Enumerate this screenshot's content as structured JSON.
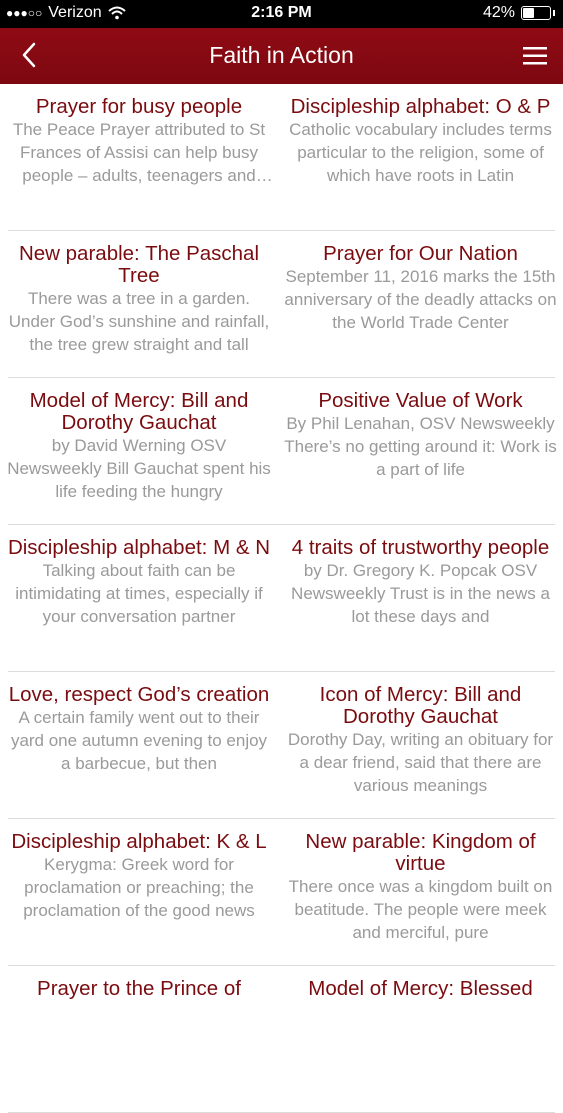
{
  "status": {
    "carrier": "Verizon",
    "time": "2:16 PM",
    "battery": "42%",
    "battery_level": 0.42
  },
  "header": {
    "title": "Faith in Action"
  },
  "articles": [
    {
      "title": "Prayer for busy people",
      "excerpt": "The Peace Prayer attributed to St Frances of Assisi can help busy people – adults, teenagers and children alike"
    },
    {
      "title": "Discipleship alphabet: O & P",
      "excerpt": "Catholic vocabulary includes terms particular to the religion, some of which have roots in Latin"
    },
    {
      "title": "New parable: The Paschal Tree",
      "excerpt": "There was a tree in a garden. Under God’s sunshine and rainfall, the tree grew straight and tall"
    },
    {
      "title": "Prayer for Our Nation",
      "excerpt": "September 11, 2016 marks the 15th anniversary of the deadly attacks on the World Trade Center"
    },
    {
      "title": "Model of Mercy: Bill and Dorothy Gauchat",
      "excerpt": "by David Werning OSV Newsweekly Bill Gauchat spent his life feeding the hungry"
    },
    {
      "title": "Positive Value of Work",
      "excerpt": "By Phil Lenahan, OSV Newsweekly There’s no getting around it: Work is a part of life"
    },
    {
      "title": "Discipleship alphabet: M & N",
      "excerpt": "Talking about faith can be intimidating at times, especially if your conversation partner"
    },
    {
      "title": "4 traits of trustworthy people",
      "excerpt": "by Dr. Gregory K. Popcak OSV Newsweekly Trust is in the news a lot these days and"
    },
    {
      "title": "Love, respect God’s creation",
      "excerpt": "A certain family went out to their yard one autumn evening to enjoy a barbecue, but then"
    },
    {
      "title": "Icon of Mercy: Bill and Dorothy Gauchat",
      "excerpt": "Dorothy Day, writing an obituary for a dear friend, said that there are various meanings"
    },
    {
      "title": "Discipleship alphabet: K & L",
      "excerpt": "Kerygma: Greek word for proclamation or preaching; the proclamation of the good news"
    },
    {
      "title": "New parable: Kingdom of virtue",
      "excerpt": "There once was a kingdom built on beatitude. The people were meek and merciful, pure"
    },
    {
      "title": "Prayer to the Prince of",
      "excerpt": ""
    },
    {
      "title": "Model of Mercy: Blessed",
      "excerpt": ""
    }
  ],
  "colors": {
    "nav_bar": "#8c0a12",
    "title_text": "#7a0c10",
    "excerpt_text": "#9a9a9a"
  },
  "icons": {
    "back": "chevron-left-icon",
    "menu": "hamburger-menu-icon",
    "wifi": "wifi-icon",
    "battery": "battery-icon"
  }
}
